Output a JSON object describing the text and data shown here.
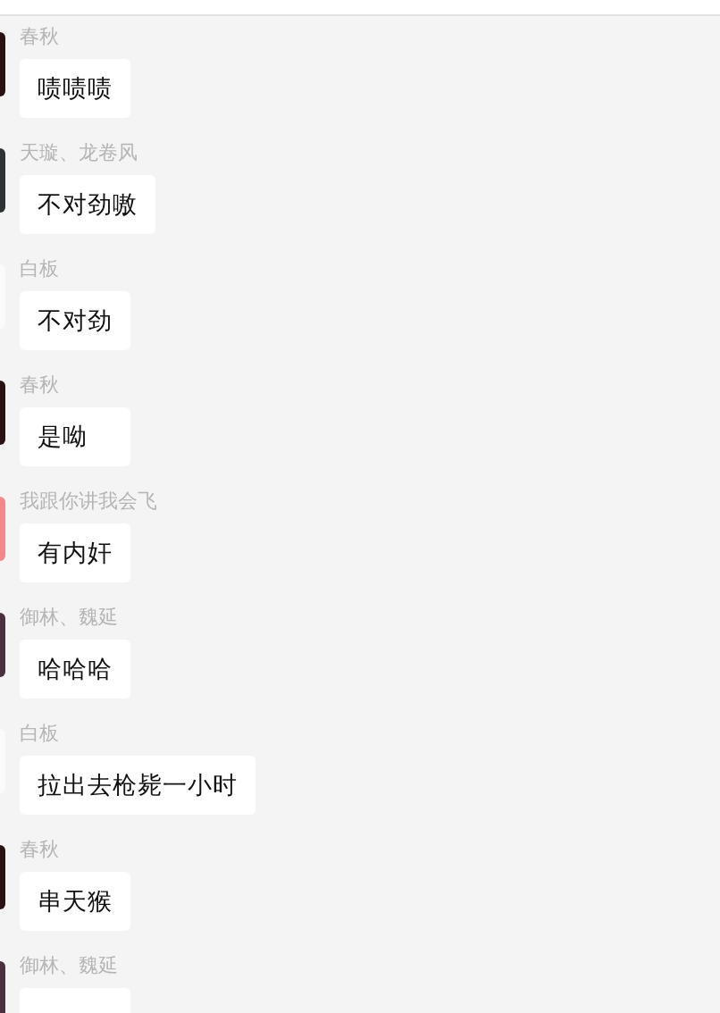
{
  "messages": [
    {
      "sender": "春秋",
      "text": "啧啧啧",
      "color": "#2a1212"
    },
    {
      "sender": "天璇、龙卷风",
      "text": "不对劲嗷",
      "color": "#2d3335"
    },
    {
      "sender": "白板",
      "text": "不对劲",
      "color": "#fafafa"
    },
    {
      "sender": "春秋",
      "text": "是呦",
      "color": "#2a1212"
    },
    {
      "sender": "我跟你讲我会飞",
      "text": "有内奸",
      "color": "#f08a8a"
    },
    {
      "sender": "御林、魏延",
      "text": "哈哈哈",
      "color": "#4a3040"
    },
    {
      "sender": "白板",
      "text": "拉出去枪毙一小时",
      "color": "#fafafa"
    },
    {
      "sender": "春秋",
      "text": "串天猴",
      "color": "#2a1212"
    },
    {
      "sender": "御林、魏延",
      "color": "#4a3040"
    }
  ]
}
